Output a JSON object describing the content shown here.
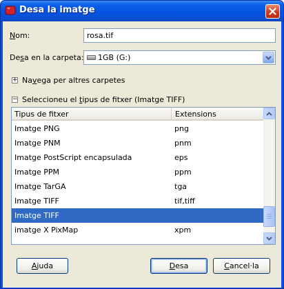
{
  "window": {
    "title": "Desa la imatge"
  },
  "form": {
    "name_label_pre": "",
    "name_label_u": "N",
    "name_label_post": "om:",
    "name_value": "rosa.tif",
    "folder_label_pre": "De",
    "folder_label_u": "s",
    "folder_label_post": "a en la carpeta:",
    "folder_value": "1GB (G:)",
    "browse_label_pre": "Na",
    "browse_label_u": "v",
    "browse_label_post": "ega per altres carpetes",
    "filetype_label_pre": "Seleccioneu el ",
    "filetype_label_u": "t",
    "filetype_label_post": "ipus de fitxer (Imatge TIFF)"
  },
  "file_types": {
    "columns": [
      "Tipus de fitxer",
      "Extensions"
    ],
    "rows": [
      {
        "type": "Imatge PNG",
        "ext": "png"
      },
      {
        "type": "Imatge PNM",
        "ext": "pnm"
      },
      {
        "type": "Imatge PostScript encapsulada",
        "ext": "eps"
      },
      {
        "type": "Imatge PPM",
        "ext": "ppm"
      },
      {
        "type": "Imatge TarGA",
        "ext": "tga"
      },
      {
        "type": "Imatge TIFF",
        "ext": "tif,tiff"
      },
      {
        "type": "Imatge TIFF",
        "ext": ""
      },
      {
        "type": "imatge X PixMap",
        "ext": "xpm"
      }
    ],
    "selected_index": 6,
    "selection_color": "#316ac5"
  },
  "buttons": {
    "help_pre": "",
    "help_u": "A",
    "help_post": "juda",
    "save_pre": "",
    "save_u": "D",
    "save_post": "esa",
    "cancel_pre": "",
    "cancel_u": "C",
    "cancel_post": "ancel·la"
  },
  "icons": {
    "title": "gimp-window-icon",
    "close": "close-icon",
    "drive": "drive-icon",
    "dropdown": "chevron-down-icon",
    "expand": "plus-icon",
    "collapse": "minus-icon",
    "scroll_up": "arrow-up-icon",
    "scroll_down": "arrow-down-icon"
  }
}
